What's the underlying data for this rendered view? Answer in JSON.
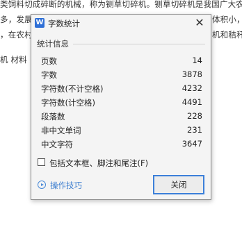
{
  "document": {
    "lines": [
      "类饲料切成碎断的机械，称为铡草切碎机。铡草切碎机是我国广大农",
      "多，发展",
      "体积小，",
      "，在农村",
      "机和秸秆",
      "机  材料"
    ]
  },
  "dialog": {
    "title": "字数统计",
    "app_icon": "W",
    "group_title": "统计信息",
    "stats": [
      {
        "label": "页数",
        "value": "14"
      },
      {
        "label": "字数",
        "value": "3878"
      },
      {
        "label": "字符数(不计空格)",
        "value": "4232"
      },
      {
        "label": "字符数(计空格)",
        "value": "4491"
      },
      {
        "label": "段落数",
        "value": "228"
      },
      {
        "label": "非中文单词",
        "value": "231"
      },
      {
        "label": "中文字符",
        "value": "3647"
      }
    ],
    "checkbox_label": "包括文本框、脚注和尾注(F)",
    "checkbox_checked": false,
    "tips_label": "操作技巧",
    "close_button": "关闭",
    "close_glyph": "✕"
  }
}
